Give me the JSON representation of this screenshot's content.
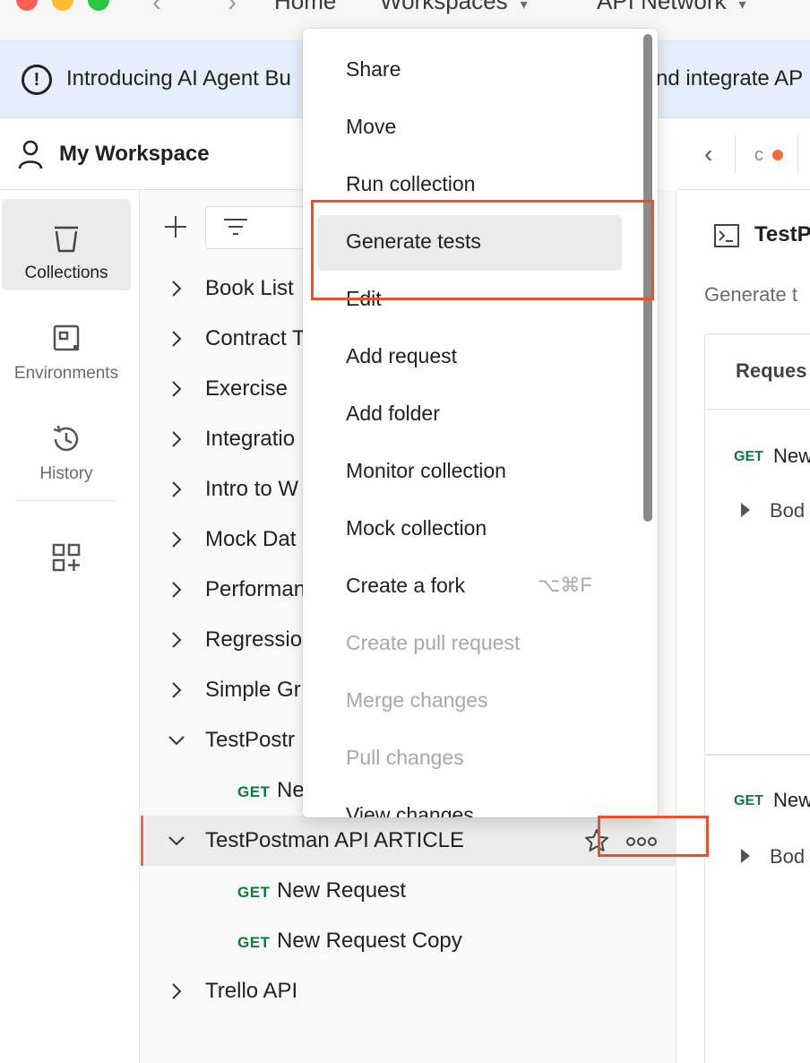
{
  "titlebar": {
    "home": "Home",
    "workspaces": "Workspaces",
    "api_network": "API Network"
  },
  "banner": {
    "text_left": "Introducing AI Agent Bu",
    "text_right": "nd integrate AP"
  },
  "workspace": {
    "name": "My Workspace"
  },
  "rail": {
    "items": [
      {
        "label": "Collections",
        "icon": "trash-can-icon"
      },
      {
        "label": "Environments",
        "icon": "environment-icon"
      },
      {
        "label": "History",
        "icon": "history-icon"
      },
      {
        "label": "",
        "icon": "add-apps-icon"
      }
    ]
  },
  "collections": {
    "items": [
      {
        "label": "Book List"
      },
      {
        "label": "Contract T"
      },
      {
        "label": "Exercise"
      },
      {
        "label": "Integratio"
      },
      {
        "label": "Intro to W"
      },
      {
        "label": "Mock Dat"
      },
      {
        "label": "Performan"
      },
      {
        "label": "Regressio"
      },
      {
        "label": "Simple Gr"
      },
      {
        "label": "TestPostr"
      },
      {
        "label": "TestPostman API ARTICLE"
      },
      {
        "label": "Trello API"
      }
    ],
    "requests": [
      {
        "method": "GET",
        "label": "Ne"
      },
      {
        "method": "GET",
        "label": "New Request"
      },
      {
        "method": "GET",
        "label": "New Request Copy"
      }
    ]
  },
  "context_menu": {
    "items": [
      {
        "label": "Share"
      },
      {
        "label": "Move"
      },
      {
        "label": "Run collection"
      },
      {
        "label": "Generate tests"
      },
      {
        "label": "Edit"
      },
      {
        "label": "Add request"
      },
      {
        "label": "Add folder"
      },
      {
        "label": "Monitor collection"
      },
      {
        "label": "Mock collection"
      },
      {
        "label": "Create a fork",
        "shortcut": "⌥⌘F"
      },
      {
        "label": "Create pull request"
      },
      {
        "label": "Merge changes"
      },
      {
        "label": "Pull changes"
      },
      {
        "label": "View changes"
      }
    ]
  },
  "right_pane": {
    "tab_letter": "c",
    "title": "TestP",
    "subtitle": "Generate t",
    "card_header": "Reques",
    "get1": "GET",
    "new1": "New",
    "body1": "Bod",
    "get2": "GET",
    "new2": "New",
    "body2": "Bod"
  },
  "colors": {
    "accent": "#f26b3a",
    "highlight": "#e8522a",
    "get_green": "#0b7a3a",
    "banner_bg": "#e6eefb"
  }
}
